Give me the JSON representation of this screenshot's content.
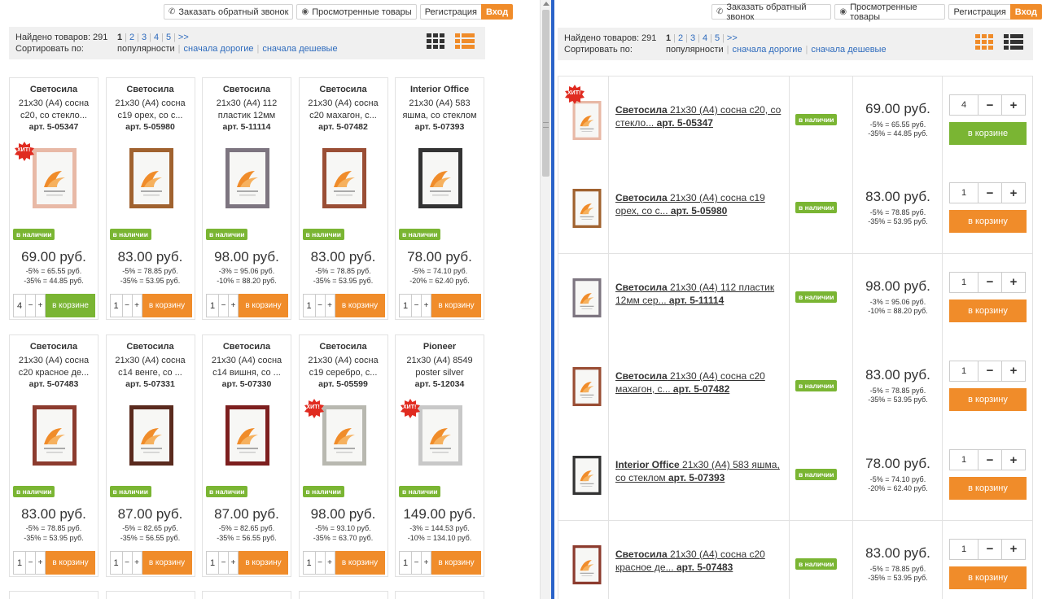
{
  "header": {
    "callback": "Заказать обратный звонок",
    "viewed": "Просмотренные товары",
    "register": "Регистрация",
    "login": "Вход"
  },
  "sortbar": {
    "found": "Найдено товаров: 291",
    "sort_label": "Сортировать по:",
    "pages": [
      "1",
      "2",
      "3",
      "4",
      "5",
      ">>"
    ],
    "current_page": "1",
    "sort_options": [
      "популярности",
      "сначала дорогие",
      "сначала дешевые"
    ],
    "active_sort": "популярности"
  },
  "labels": {
    "in_stock": "в наличии",
    "to_cart": "в корзину",
    "in_cart": "в корзине",
    "hit": "ХИТ!"
  },
  "colors": {
    "accent": "#f08c2a",
    "green": "#7ab533",
    "divider": "#2a63c9",
    "link": "#2e6bbd"
  },
  "grid_products": [
    {
      "brand": "Светосила",
      "desc": "21x30 (A4) сосна с20, со стекло...",
      "art": "арт. 5-05347",
      "price": "69.00 руб.",
      "d1": "-5% = 65.55 руб.",
      "d2": "-35% = 44.85 руб.",
      "qty": "4",
      "hit": true,
      "in_cart": true,
      "frame": "#e8b9a6"
    },
    {
      "brand": "Светосила",
      "desc": "21x30 (A4) сосна с19 орех, со с...",
      "art": "арт. 5-05980",
      "price": "83.00 руб.",
      "d1": "-5% = 78.85 руб.",
      "d2": "-35% = 53.95 руб.",
      "qty": "1",
      "hit": false,
      "in_cart": false,
      "frame": "#a0622f"
    },
    {
      "brand": "Светосила",
      "desc": "21x30 (A4) 112 пластик 12мм сер...",
      "art": "арт. 5-11114",
      "price": "98.00 руб.",
      "d1": "-3% = 95.06 руб.",
      "d2": "-10% = 88.20 руб.",
      "qty": "1",
      "hit": false,
      "in_cart": false,
      "frame": "#7d7580"
    },
    {
      "brand": "Светосила",
      "desc": "21x30 (A4) сосна с20 махагон, с...",
      "art": "арт. 5-07482",
      "price": "83.00 руб.",
      "d1": "-5% = 78.85 руб.",
      "d2": "-35% = 53.95 руб.",
      "qty": "1",
      "hit": false,
      "in_cart": false,
      "frame": "#9a4e35"
    },
    {
      "brand": "Interior Office",
      "desc": "21x30 (A4) 583 яшма, со стеклом",
      "art": "арт. 5-07393",
      "price": "78.00 руб.",
      "d1": "-5% = 74.10 руб.",
      "d2": "-20% = 62.40 руб.",
      "qty": "1",
      "hit": false,
      "in_cart": false,
      "frame": "#333333"
    },
    {
      "brand": "Светосила",
      "desc": "21x30 (A4) сосна с20 красное де...",
      "art": "арт. 5-07483",
      "price": "83.00 руб.",
      "d1": "-5% = 78.85 руб.",
      "d2": "-35% = 53.95 руб.",
      "qty": "1",
      "hit": false,
      "in_cart": false,
      "frame": "#8c3b2e"
    },
    {
      "brand": "Светосила",
      "desc": "21x30 (A4) сосна с14 венге, со ...",
      "art": "арт. 5-07331",
      "price": "87.00 руб.",
      "d1": "-5% = 82.65 руб.",
      "d2": "-35% = 56.55 руб.",
      "qty": "1",
      "hit": false,
      "in_cart": false,
      "frame": "#5a2a1e"
    },
    {
      "brand": "Светосила",
      "desc": "21x30 (A4) сосна с14 вишня, со ...",
      "art": "арт. 5-07330",
      "price": "87.00 руб.",
      "d1": "-5% = 82.65 руб.",
      "d2": "-35% = 56.55 руб.",
      "qty": "1",
      "hit": false,
      "in_cart": false,
      "frame": "#7d1f1f"
    },
    {
      "brand": "Светосила",
      "desc": "21x30 (A4) сосна с19 серебро, с...",
      "art": "арт. 5-05599",
      "price": "98.00 руб.",
      "d1": "-5% = 93.10 руб.",
      "d2": "-35% = 63.70 руб.",
      "qty": "1",
      "hit": true,
      "in_cart": false,
      "frame": "#b8b8b0"
    },
    {
      "brand": "Pioneer",
      "desc": "21x30 (A4) 8549 poster silver",
      "art": "арт. 5-12034",
      "price": "149.00 руб.",
      "d1": "-3% = 144.53 руб.",
      "d2": "-10% = 134.10 руб.",
      "qty": "1",
      "hit": true,
      "in_cart": false,
      "frame": "#c8c8c8"
    }
  ],
  "list_products": [
    {
      "brand": "Светосила",
      "desc": "21x30 (A4) сосна с20, со стекло...",
      "art": "арт. 5-05347",
      "price": "69.00 руб.",
      "d1": "-5% = 65.55 руб.",
      "d2": "-35% = 44.85 руб.",
      "qty": "4",
      "hit": true,
      "in_cart": true,
      "frame": "#e8b9a6"
    },
    {
      "brand": "Светосила",
      "desc": "21x30 (A4) сосна с19 орех, со с...",
      "art": "арт. 5-05980",
      "price": "83.00 руб.",
      "d1": "-5% = 78.85 руб.",
      "d2": "-35% = 53.95 руб.",
      "qty": "1",
      "hit": false,
      "in_cart": false,
      "frame": "#a0622f"
    },
    {
      "brand": "Светосила",
      "desc": "21x30 (A4) 112 пластик 12мм сер...",
      "art": "арт. 5-11114",
      "price": "98.00 руб.",
      "d1": "-3% = 95.06 руб.",
      "d2": "-10% = 88.20 руб.",
      "qty": "1",
      "hit": false,
      "in_cart": false,
      "frame": "#7d7580"
    },
    {
      "brand": "Светосила",
      "desc": "21x30 (A4) сосна с20 махагон, с...",
      "art": "арт. 5-07482",
      "price": "83.00 руб.",
      "d1": "-5% = 78.85 руб.",
      "d2": "-35% = 53.95 руб.",
      "qty": "1",
      "hit": false,
      "in_cart": false,
      "frame": "#9a4e35"
    },
    {
      "brand": "Interior Office",
      "desc": "21x30 (A4) 583 яшма, со стеклом",
      "art": "арт. 5-07393",
      "price": "78.00 руб.",
      "d1": "-5% = 74.10 руб.",
      "d2": "-20% = 62.40 руб.",
      "qty": "1",
      "hit": false,
      "in_cart": false,
      "frame": "#333333"
    },
    {
      "brand": "Светосила",
      "desc": "21x30 (A4) сосна с20 красное де...",
      "art": "арт. 5-07483",
      "price": "83.00 руб.",
      "d1": "-5% = 78.85 руб.",
      "d2": "-35% = 53.95 руб.",
      "qty": "1",
      "hit": false,
      "in_cart": false,
      "frame": "#8c3b2e"
    }
  ]
}
